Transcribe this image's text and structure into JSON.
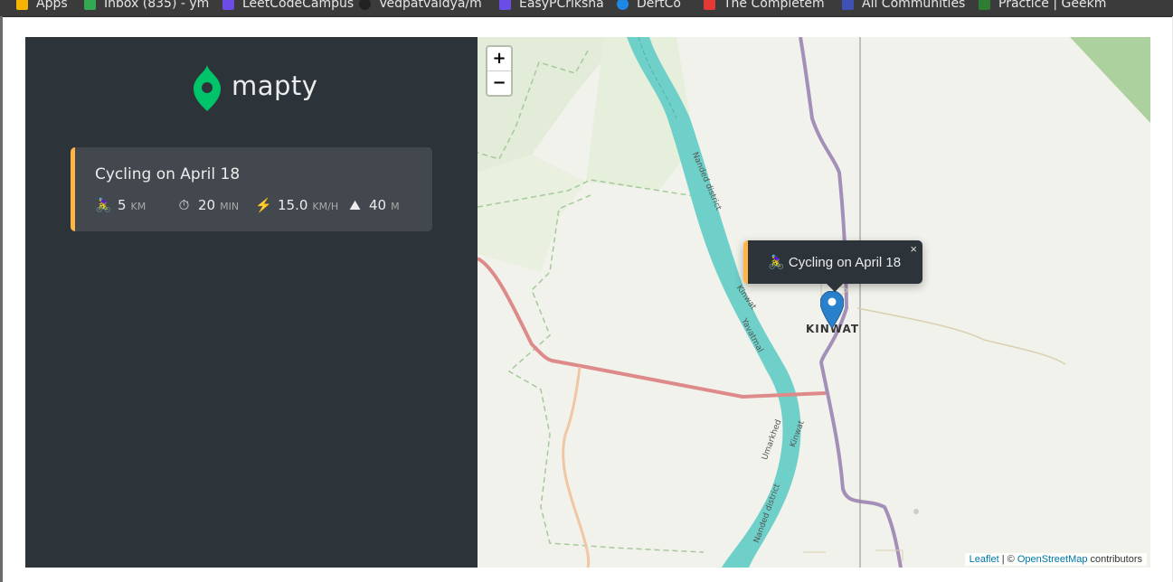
{
  "bookmarks": [
    {
      "label": "Apps",
      "color": "#f4b400"
    },
    {
      "label": "Inbox (835) - ym",
      "color": "#34a853"
    },
    {
      "label": "LeetCodeCampus",
      "color": "#6b4ce6"
    },
    {
      "label": "Vedpatvaidya/m",
      "color": "#222222"
    },
    {
      "label": "EasyPCriksha",
      "color": "#6b4ce6"
    },
    {
      "label": "DertCo",
      "color": "#1e88e5"
    },
    {
      "label": "The Completem",
      "color": "#e53935"
    },
    {
      "label": "All Communities",
      "color": "#3f51b5"
    },
    {
      "label": "Practice | Geekm",
      "color": "#2e7d32"
    }
  ],
  "app": {
    "logo_text": "mapty"
  },
  "workouts": [
    {
      "title": "Cycling on April 18",
      "type": "cycling",
      "details": [
        {
          "icon": "🚴‍♀️",
          "icon_name": "cyclist-icon",
          "value": "5",
          "unit": "km"
        },
        {
          "icon": "⏱",
          "icon_name": "stopwatch-icon",
          "value": "20",
          "unit": "min"
        },
        {
          "icon": "⚡️",
          "icon_name": "lightning-icon",
          "value": "15.0",
          "unit": "km/h"
        },
        {
          "icon": "⛰",
          "icon_name": "mountain-icon",
          "value": "40",
          "unit": "m"
        }
      ]
    }
  ],
  "map": {
    "zoom_in": "+",
    "zoom_out": "−",
    "popup": {
      "icon": "🚴‍♀️",
      "text": "Cycling on April 18",
      "close": "×"
    },
    "city_label": "KINWAT",
    "labels": [
      "Nanded district",
      "Kinwat",
      "Yavatmal",
      "Umarkhed",
      "Kinwat",
      "Nanded district"
    ],
    "attribution": {
      "leaflet": "Leaflet",
      "sep": " | © ",
      "osm": "OpenStreetMap",
      "tail": " contributors"
    }
  },
  "colors": {
    "sidebar_bg": "#2d3439",
    "card_bg": "#42484d",
    "accent_cycling": "#ffb545",
    "brand_green": "#00c46a",
    "river": "#6ed0c9",
    "road_red": "#de8a8a",
    "road_purple": "#a38fb8"
  }
}
